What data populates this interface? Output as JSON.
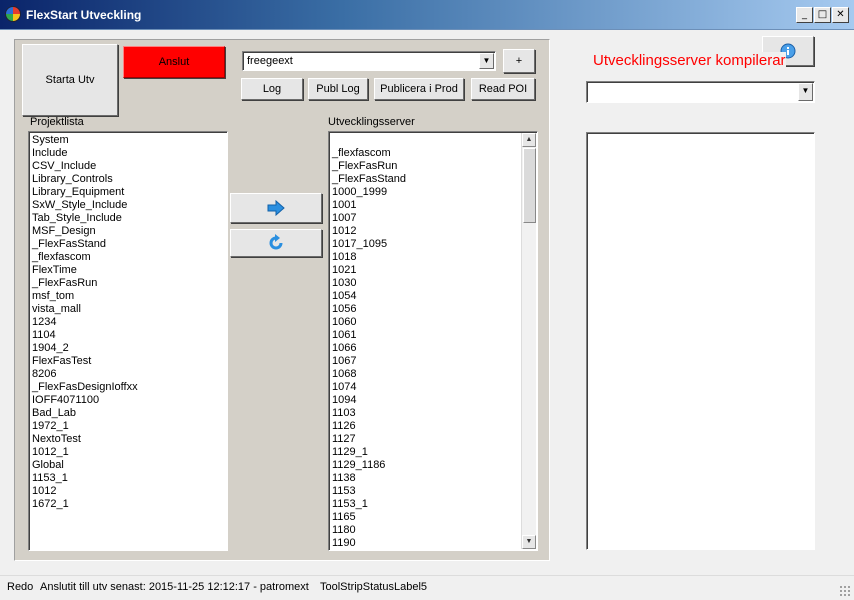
{
  "window": {
    "title": "FlexStart Utveckling",
    "minimize": "_",
    "maximize": "□",
    "close": "✕"
  },
  "buttons": {
    "starta": "Starta Utv",
    "anslut": "Anslut",
    "plus": "+",
    "log": "Log",
    "publ_log": "Publ Log",
    "publicera": "Publicera i Prod",
    "read_poi": "Read POI"
  },
  "server_combo": {
    "value": "freegeext"
  },
  "labels": {
    "projektlista": "Projektlista",
    "utvecklingsserver": "Utvecklingsserver",
    "status_message": "Utvecklingsserver kompilerar"
  },
  "projektlista": [
    "System",
    "Include",
    "CSV_Include",
    "Library_Controls",
    "Library_Equipment",
    "SxW_Style_Include",
    "Tab_Style_Include",
    "MSF_Design",
    "_FlexFasStand",
    "_flexfascom",
    "FlexTime",
    "_FlexFasRun",
    "msf_tom",
    "vista_mall",
    "1234",
    "1104",
    "1904_2",
    "FlexFasTest",
    "8206",
    "_FlexFasDesignIoffxx",
    "IOFF4071100",
    "Bad_Lab",
    "1972_1",
    "NextoTest",
    "1012_1",
    "Global",
    "1153_1",
    "1012",
    "1672_1"
  ],
  "utvecklingsserver": [
    "",
    "_flexfascom",
    "_FlexFasRun",
    "_FlexFasStand",
    "1000_1999",
    "1001",
    "1007",
    "1012",
    "1017_1095",
    "1018",
    "1021",
    "1030",
    "1054",
    "1056",
    "1060",
    "1061",
    "1066",
    "1067",
    "1068",
    "1074",
    "1094",
    "1103",
    "1126",
    "1127",
    "1129_1",
    "1129_1186",
    "1138",
    "1153",
    "1153_1",
    "1165",
    "1180",
    "1190"
  ],
  "right_combo": {
    "value": ""
  },
  "statusbar": {
    "redo": "Redo",
    "connected": "Anslutit till utv senast: 2015-11-25 12:12:17 - patromext",
    "label5": "ToolStripStatusLabel5"
  },
  "colors": {
    "anslut_bg": "#ff0000",
    "status_message": "#ff0000",
    "arrow_icon": "#2a8fe0"
  },
  "icons": {
    "transfer": "arrow-right-icon",
    "refresh": "refresh-icon",
    "info": "info-icon",
    "app": "app-icon"
  }
}
